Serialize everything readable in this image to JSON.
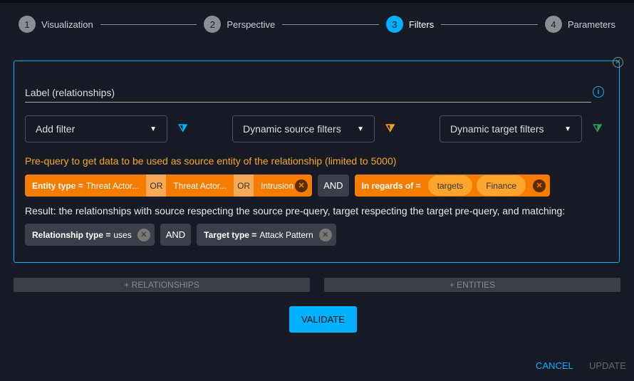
{
  "stepper": [
    {
      "num": "1",
      "label": "Visualization"
    },
    {
      "num": "2",
      "label": "Perspective"
    },
    {
      "num": "3",
      "label": "Filters"
    },
    {
      "num": "4",
      "label": "Parameters"
    }
  ],
  "panel": {
    "label_field": "Label (relationships)",
    "add_filter": "Add filter",
    "dynamic_source": "Dynamic source filters",
    "dynamic_target": "Dynamic target filters",
    "prequery_text": "Pre-query to get data to be used as source entity of the relationship (limited to 5000)",
    "source_filters": {
      "entity_key": "Entity type =",
      "values": [
        "Threat Actor...",
        "Threat Actor...",
        "Intrusion"
      ],
      "or": "OR",
      "and": "AND",
      "regards_key": "In regards of =",
      "regards_values": [
        "targets",
        "Finance"
      ]
    },
    "result_text": "Result: the relationships with source respecting the source pre-query, target respecting the target pre-query, and matching:",
    "result_filters": {
      "rel_key": "Relationship type =",
      "rel_value": "uses",
      "and": "AND",
      "target_key": "Target type =",
      "target_value": "Attack Pattern"
    }
  },
  "add_relationships": "+ RELATIONSHIPS",
  "add_entities": "+ ENTITIES",
  "validate": "VALIDATE",
  "cancel": "CANCEL",
  "update": "UPDATE",
  "colors": {
    "accent": "#00b1ff",
    "orange": "#f57c00",
    "green": "#2e9e4f"
  }
}
